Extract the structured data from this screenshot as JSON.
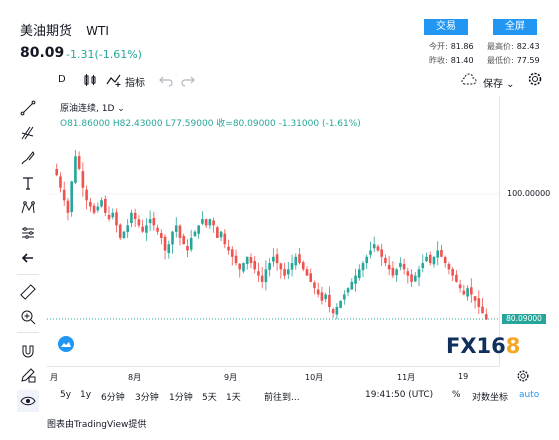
{
  "header": {
    "name": "美油期货",
    "symbol": "WTI",
    "price": "80.09",
    "change": "-1.31(-1.61%)",
    "trade_button": "交易",
    "fullscreen_button": "全屏",
    "stats": {
      "open_label": "今开:",
      "open": "81.86",
      "high_label": "最高价:",
      "high": "82.43",
      "prev_label": "昨收:",
      "prev": "81.40",
      "low_label": "最低价:",
      "low": "77.59"
    }
  },
  "toolbar": {
    "interval": "D",
    "indicators": "指标",
    "save": "保存"
  },
  "chart": {
    "legend_title": "原油连续, 1D",
    "ohlc": "O81.86000  H82.43000  L77.59000  收=80.09000  -1.31000 (-1.61%)",
    "y_label": "100.00000",
    "price_label": "80.09000",
    "x_labels": [
      "月",
      "8月",
      "9月",
      "10月",
      "11月",
      "19"
    ],
    "watermark_a": "FX16",
    "watermark_b": "8"
  },
  "chart_data": {
    "type": "candlestick",
    "last": 80.09,
    "y_ticks": [
      100
    ],
    "x_labels": [
      "月",
      "8月",
      "9月",
      "10月",
      "11月",
      "19"
    ],
    "colors": {
      "up": "#26a69a",
      "down": "#ef5350"
    }
  },
  "bottom": {
    "ranges": [
      "5y",
      "1y",
      "6分钟",
      "3分钟",
      "1分钟",
      "5天",
      "1天"
    ],
    "goto": "前往到...",
    "time": "19:41:50 (UTC)",
    "percent": "%",
    "log": "对数坐标",
    "auto": "auto"
  },
  "credit": "图表由TradingView提供"
}
